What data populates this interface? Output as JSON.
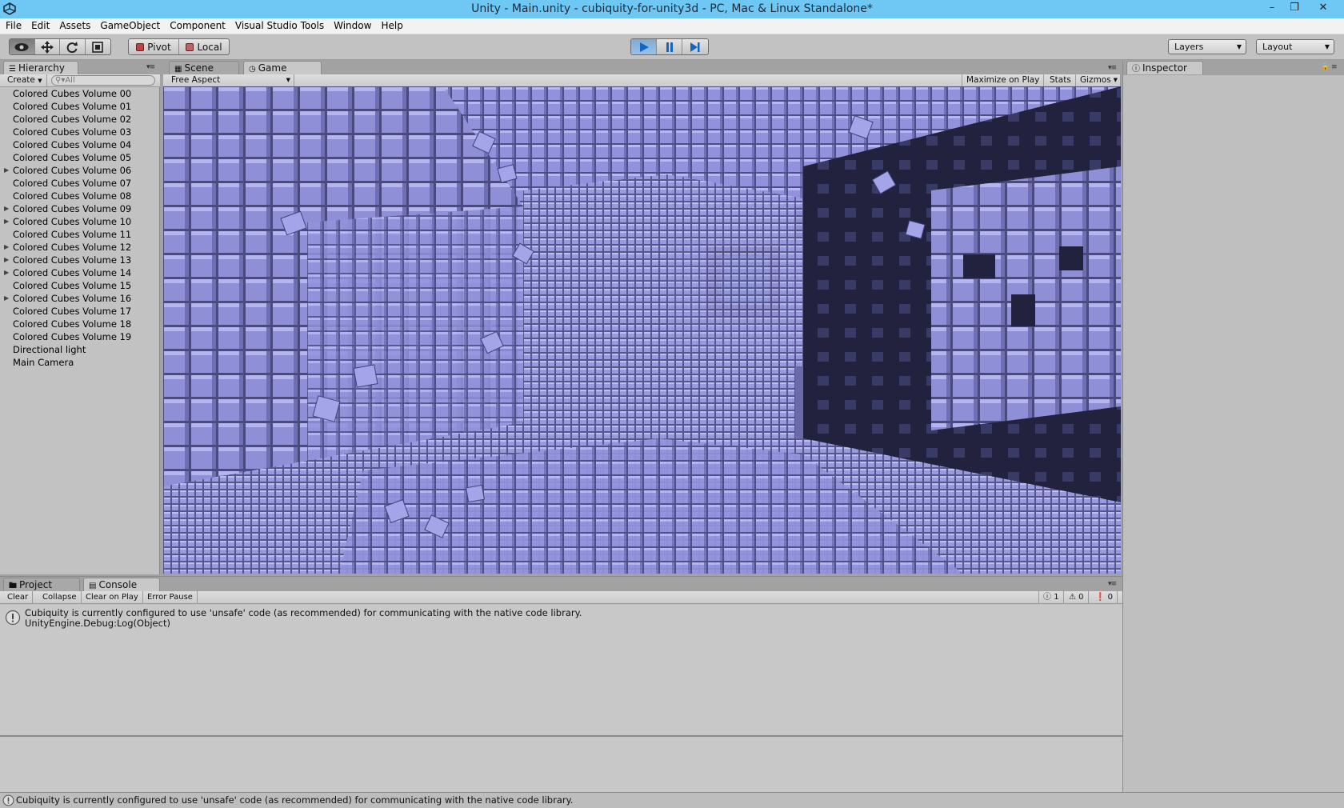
{
  "window": {
    "title": "Unity - Main.unity - cubiquity-for-unity3d - PC, Mac & Linux Standalone*"
  },
  "menu": [
    "File",
    "Edit",
    "Assets",
    "GameObject",
    "Component",
    "Visual Studio Tools",
    "Window",
    "Help"
  ],
  "toolbar": {
    "pivot_label": "Pivot",
    "local_label": "Local",
    "layers_label": "Layers",
    "layout_label": "Layout",
    "play_state": "playing"
  },
  "hierarchy": {
    "tab_label": "Hierarchy",
    "create_label": "Create",
    "search_placeholder": "All",
    "items": [
      {
        "label": "Colored Cubes Volume 00",
        "expandable": false
      },
      {
        "label": "Colored Cubes Volume 01",
        "expandable": false
      },
      {
        "label": "Colored Cubes Volume 02",
        "expandable": false
      },
      {
        "label": "Colored Cubes Volume 03",
        "expandable": false
      },
      {
        "label": "Colored Cubes Volume 04",
        "expandable": false
      },
      {
        "label": "Colored Cubes Volume 05",
        "expandable": false
      },
      {
        "label": "Colored Cubes Volume 06",
        "expandable": true
      },
      {
        "label": "Colored Cubes Volume 07",
        "expandable": false
      },
      {
        "label": "Colored Cubes Volume 08",
        "expandable": false
      },
      {
        "label": "Colored Cubes Volume 09",
        "expandable": true
      },
      {
        "label": "Colored Cubes Volume 10",
        "expandable": true
      },
      {
        "label": "Colored Cubes Volume 11",
        "expandable": false
      },
      {
        "label": "Colored Cubes Volume 12",
        "expandable": true
      },
      {
        "label": "Colored Cubes Volume 13",
        "expandable": true
      },
      {
        "label": "Colored Cubes Volume 14",
        "expandable": true
      },
      {
        "label": "Colored Cubes Volume 15",
        "expandable": false
      },
      {
        "label": "Colored Cubes Volume 16",
        "expandable": true
      },
      {
        "label": "Colored Cubes Volume 17",
        "expandable": false
      },
      {
        "label": "Colored Cubes Volume 18",
        "expandable": false
      },
      {
        "label": "Colored Cubes Volume 19",
        "expandable": false
      },
      {
        "label": "Directional light",
        "expandable": false
      },
      {
        "label": "Main Camera",
        "expandable": false
      }
    ]
  },
  "view_tabs": {
    "scene_label": "Scene",
    "game_label": "Game",
    "aspect_label": "Free Aspect",
    "maximize_label": "Maximize on Play",
    "stats_label": "Stats",
    "gizmos_label": "Gizmos"
  },
  "inspector": {
    "tab_label": "Inspector"
  },
  "console": {
    "project_tab_label": "Project",
    "console_tab_label": "Console",
    "buttons": {
      "clear": "Clear",
      "collapse": "Collapse",
      "clear_on_play": "Clear on Play",
      "error_pause": "Error Pause"
    },
    "counts": {
      "info": "1",
      "warnings": "0",
      "errors": "0"
    },
    "messages": [
      {
        "line1": "Cubiquity is currently configured to use 'unsafe' code (as recommended) for communicating with the native code library.",
        "line2": "UnityEngine.Debug:Log(Object)"
      }
    ]
  },
  "statusbar": {
    "message": "Cubiquity is currently configured to use 'unsafe' code (as recommended) for communicating with the native code library."
  },
  "colors": {
    "titlebar": "#6ec8f3",
    "editor_bg": "#a2a2a2",
    "game_cubes": "#8c8cd6",
    "play_active": "#7ea9d6"
  }
}
